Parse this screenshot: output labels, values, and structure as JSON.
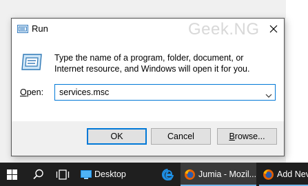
{
  "dialog": {
    "title": "Run",
    "watermark": "Geek.NG",
    "description": "Type the name of a program, folder, document, or Internet resource, and Windows will open it for you.",
    "open_label_accel": "O",
    "open_label_rest": "pen:",
    "input_value": "services.msc",
    "ok_label": "OK",
    "cancel_label": "Cancel",
    "browse_accel": "B",
    "browse_rest": "rowse..."
  },
  "taskbar": {
    "desktop_label": "Desktop",
    "firefox_window_label": "Jumia - Mozil...",
    "add_new_label": "Add Nev"
  },
  "colors": {
    "accent": "#0078d7",
    "taskbar": "#1f1f1f",
    "taskbar_underline": "#76b9ed"
  },
  "icons": [
    "run-icon",
    "close-icon",
    "run-program-icon",
    "chevron-down-icon",
    "windows-start-icon",
    "search-icon",
    "task-view-icon",
    "desktop-icon",
    "edge-icon",
    "firefox-icon"
  ]
}
